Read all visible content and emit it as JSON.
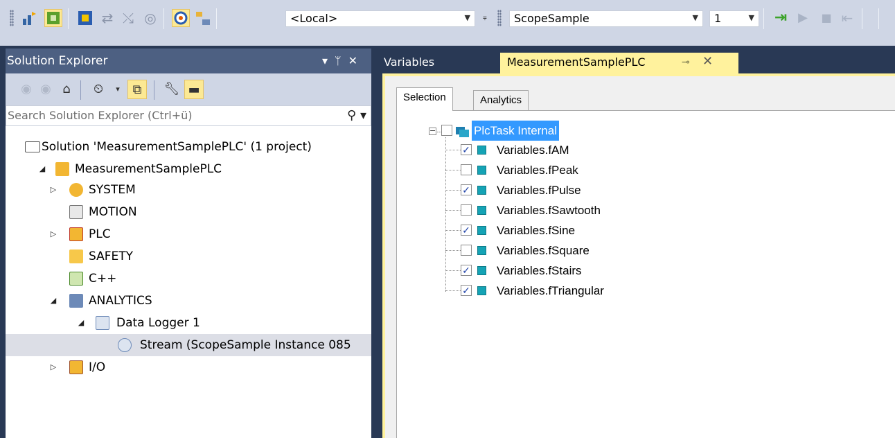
{
  "toolbar": {
    "platform_value": "<Local>",
    "config_value": "ScopeSample",
    "instance_value": "1"
  },
  "solution_explorer": {
    "title": "Solution Explorer",
    "search_placeholder": "Search Solution Explorer (Ctrl+ü)",
    "items": [
      {
        "label": "Solution 'MeasurementSamplePLC' (1 project)",
        "icon": "solution-icon"
      },
      {
        "label": "MeasurementSamplePLC",
        "icon": "project-icon"
      },
      {
        "label": "SYSTEM",
        "icon": "system-icon"
      },
      {
        "label": "MOTION",
        "icon": "motion-icon"
      },
      {
        "label": "PLC",
        "icon": "plc-icon"
      },
      {
        "label": "SAFETY",
        "icon": "safety-icon"
      },
      {
        "label": "C++",
        "icon": "cpp-icon"
      },
      {
        "label": "ANALYTICS",
        "icon": "analytics-icon"
      },
      {
        "label": "Data Logger 1",
        "icon": "data-logger-icon"
      },
      {
        "label": "Stream (ScopeSample Instance 085",
        "icon": "stream-icon"
      },
      {
        "label": "I/O",
        "icon": "io-icon"
      }
    ]
  },
  "tabs": {
    "variables": "Variables",
    "active": "MeasurementSamplePLC"
  },
  "subtabs": {
    "selection": "Selection",
    "analytics": "Analytics"
  },
  "task": {
    "label": "PlcTask Internal",
    "variables": [
      {
        "label": "Variables.fAM",
        "checked": true
      },
      {
        "label": "Variables.fPeak",
        "checked": false
      },
      {
        "label": "Variables.fPulse",
        "checked": true
      },
      {
        "label": "Variables.fSawtooth",
        "checked": false
      },
      {
        "label": "Variables.fSine",
        "checked": true
      },
      {
        "label": "Variables.fSquare",
        "checked": false
      },
      {
        "label": "Variables.fStairs",
        "checked": true
      },
      {
        "label": "Variables.fTriangular",
        "checked": true
      }
    ]
  }
}
